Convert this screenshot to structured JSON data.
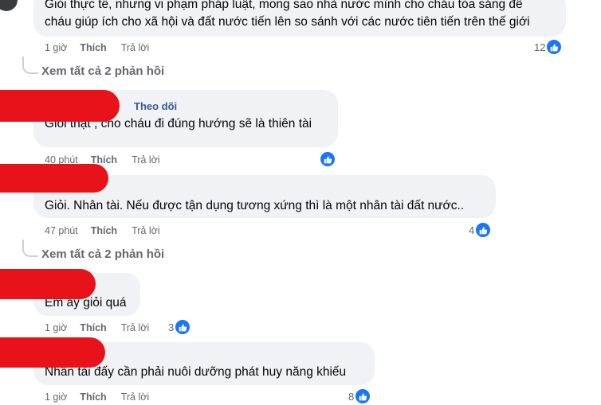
{
  "comments": [
    {
      "lines": [
        "Giỏi thực tế, nhưng vi phạm pháp luật, mong sao nhà nước mình cho cháu tỏa sáng để",
        "cháu giúp ích cho xã hội và đất nước tiến lên so sánh với các nước tiên tiến trên thế giới"
      ],
      "time": "1 giờ",
      "like_label": "Thích",
      "reply_label": "Trả lời",
      "reactions": "12"
    },
    {
      "follow_label": "Theo dõi",
      "text": "Giỏi thật , cho cháu đi đúng hướng sẽ là thiên tài",
      "time": "40 phút",
      "like_label": "Thích",
      "reply_label": "Trả lời",
      "reactions": ""
    },
    {
      "text": "Giỏi. Nhân tài. Nếu được tận dụng tương xứng thì là một nhân tài đất nước..",
      "time": "47 phút",
      "like_label": "Thích",
      "reply_label": "Trả lời",
      "reactions": "4"
    },
    {
      "text": "Em ấy giỏi quá",
      "time": "1 giờ",
      "like_label": "Thích",
      "reply_label": "Trả lời",
      "reactions": "3"
    },
    {
      "text": "Nhân tài đấy cần phải nuôi dưỡng phát huy năng khiếu",
      "time": "1 giờ",
      "like_label": "Thích",
      "reply_label": "Trả lời",
      "reactions": "8"
    }
  ],
  "view_replies": [
    "Xem tất cả 2 phản hồi",
    "Xem tất cả 2 phản hồi"
  ],
  "colors": {
    "bubble": "#f0f2f5",
    "like_blue": "#1877f2",
    "meta_gray": "#65676b",
    "redaction": "#e8131a"
  },
  "icons": {
    "reaction": "like-thumbs-up-icon"
  }
}
